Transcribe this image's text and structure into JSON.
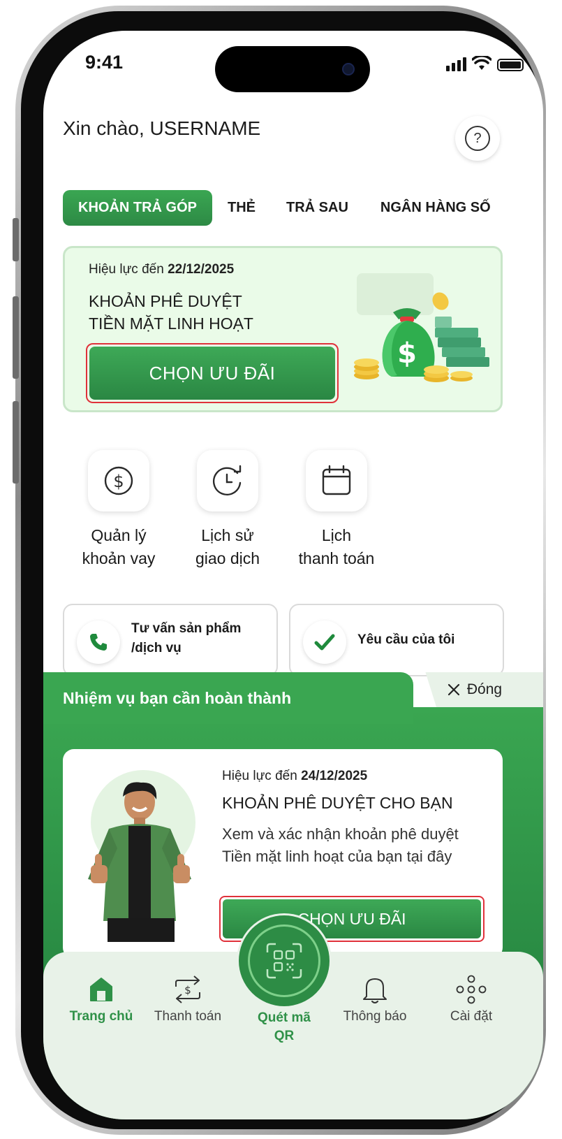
{
  "status_bar": {
    "time": "9:41"
  },
  "header": {
    "greeting": "Xin chào, USERNAME",
    "help_icon_glyph": "?"
  },
  "tabs": [
    {
      "label": "KHOẢN TRẢ GÓP",
      "active": true
    },
    {
      "label": "THẺ",
      "active": false
    },
    {
      "label": "TRẢ SAU",
      "active": false
    },
    {
      "label": "NGÂN HÀNG SỐ",
      "active": false
    }
  ],
  "promo": {
    "valid_prefix": "Hiệu lực đến",
    "valid_date": "22/12/2025",
    "title_line1": "KHOẢN PHÊ DUYỆT",
    "title_line2": "TIỀN MẶT LINH HOẠT",
    "button_label": "CHỌN ƯU ĐÃI",
    "illustration": "money-bag-icon"
  },
  "quick_actions": [
    {
      "icon": "dollar-circle-icon",
      "line1": "Quản lý",
      "line2": "khoản vay"
    },
    {
      "icon": "history-clock-icon",
      "line1": "Lịch sử",
      "line2": "giao dịch"
    },
    {
      "icon": "calendar-icon",
      "line1": "Lịch",
      "line2": "thanh toán"
    }
  ],
  "contact_cards": [
    {
      "icon": "phone-icon",
      "line1": "Tư vấn sản phẩm",
      "line2": "/dịch vụ"
    },
    {
      "icon": "check-icon",
      "line1": "Yêu cầu của tôi"
    }
  ],
  "task_sheet": {
    "title": "Nhiệm vụ bạn cần hoàn thành",
    "close_label": "Đóng",
    "valid_prefix": "Hiệu lực đến",
    "valid_date": "24/12/2025",
    "heading": "KHOẢN PHÊ DUYỆT CHO BẠN",
    "description": "Xem và xác nhận khoản phê duyệt Tiền mặt linh hoạt của bạn tại đây",
    "button_label": "CHỌN ƯU ĐÃI"
  },
  "bottom_nav": {
    "items": [
      {
        "label": "Trang chủ",
        "icon": "home-icon",
        "active": true
      },
      {
        "label": "Thanh toán",
        "icon": "transfer-icon",
        "active": false
      },
      {
        "label": "Thông báo",
        "icon": "bell-icon",
        "active": false
      },
      {
        "label": "Cài đặt",
        "icon": "settings-dots-icon",
        "active": false
      }
    ],
    "qr": {
      "line1": "Quét mã",
      "line2": "QR",
      "icon": "qr-scan-icon"
    }
  },
  "colors": {
    "brand_green": "#2f9148",
    "highlight_red": "#e0313a",
    "card_green_bg": "#eafbe8",
    "nav_bg": "#e8f2e8"
  }
}
